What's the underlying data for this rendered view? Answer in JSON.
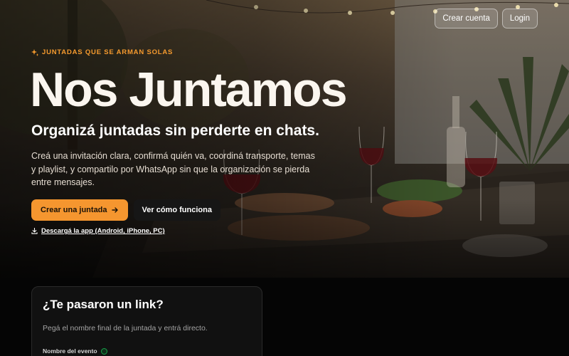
{
  "top_nav": {
    "create_account": "Crear cuenta",
    "login": "Login"
  },
  "hero": {
    "eyebrow": "JUNTADAS QUE SE ARMAN SOLAS",
    "title": "Nos Juntamos",
    "subtitle": "Organizá juntadas sin perderte en chats.",
    "description": "Creá una invitación clara, confirmá quién va, coordiná transporte, temas y playlist, y compartilo por WhatsApp sin que la organización se pierda entre mensajes.",
    "primary_cta": "Crear una juntada",
    "secondary_cta": "Ver cómo funciona",
    "download_link": "Descargá la app (Android, iPhone, PC)"
  },
  "join_card": {
    "title": "¿Te pasaron un link?",
    "description": "Pegá el nombre final de la juntada y entrá directo.",
    "field_label": "Nombre del evento"
  },
  "colors": {
    "accent": "#f5962f",
    "background": "#050505",
    "card": "#111111",
    "status_green": "#16a34a"
  },
  "icons": [
    "sparkles-icon",
    "arrow-right-icon",
    "download-icon",
    "info-icon"
  ]
}
